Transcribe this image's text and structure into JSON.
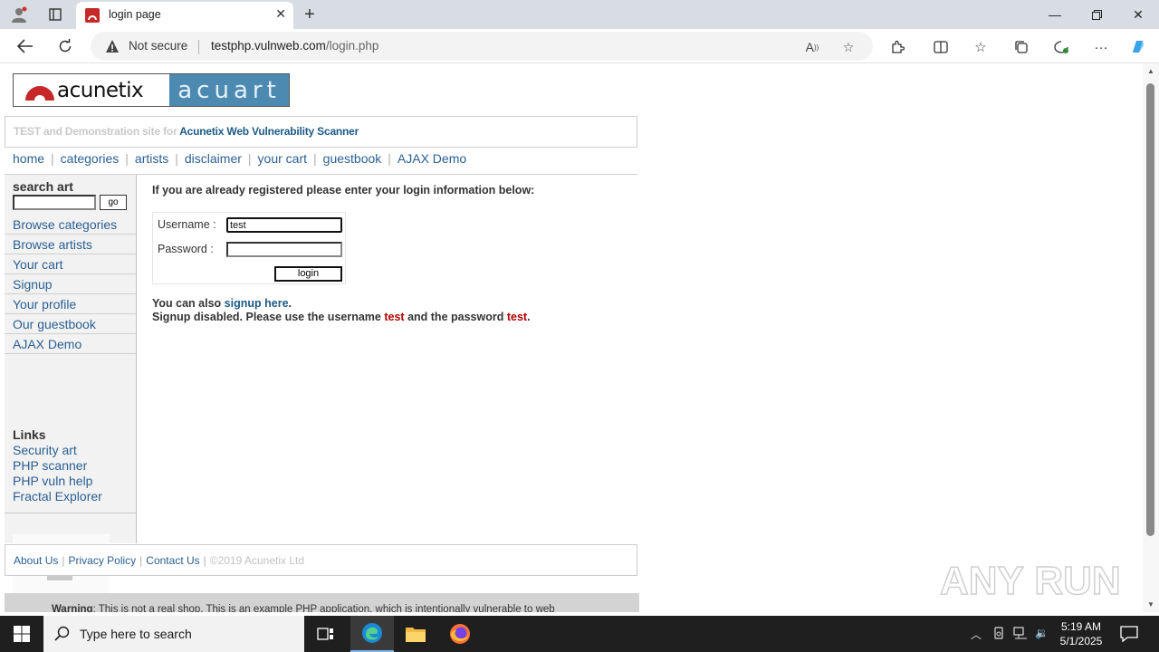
{
  "browser": {
    "tab_title": "login page",
    "security_label": "Not secure",
    "url_host": "testphp.vulnweb.com",
    "url_path": "/login.php"
  },
  "site": {
    "logo_left": "acunetix",
    "logo_right": "acuart",
    "tagline_prefix": "TEST and Demonstration site for",
    "tagline_strong": "Acunetix Web Vulnerability Scanner",
    "top_nav": [
      "home",
      "categories",
      "artists",
      "disclaimer",
      "your cart",
      "guestbook",
      "AJAX Demo"
    ],
    "search": {
      "title": "search art",
      "value": "",
      "button": "go"
    },
    "side_nav": [
      "Browse categories",
      "Browse artists",
      "Your cart",
      "Signup",
      "Your profile",
      "Our guestbook",
      "AJAX Demo"
    ],
    "links_title": "Links",
    "links": [
      "Security art",
      "PHP scanner",
      "PHP vuln help",
      "Fractal Explorer"
    ]
  },
  "login": {
    "intro": "If you are already registered please enter your login information below:",
    "username_label": "Username :",
    "username_value": "test",
    "password_label": "Password :",
    "password_value": "",
    "button": "login",
    "also_prefix": "You can also",
    "signup_link": "signup here",
    "also_suffix": ".",
    "disabled_prefix": "Signup disabled. Please use the username",
    "disabled_user": "test",
    "disabled_mid": "and the password",
    "disabled_pass": "test",
    "disabled_suffix": "."
  },
  "footer": {
    "links": [
      "About Us",
      "Privacy Policy",
      "Contact Us"
    ],
    "copyright": "©2019 Acunetix Ltd",
    "warning_strong": "Warning",
    "warning_text": ": This is not a real shop. This is an example PHP application, which is intentionally vulnerable to web"
  },
  "watermark": "ANY RUN",
  "taskbar": {
    "search_placeholder": "Type here to search",
    "time": "5:19 AM",
    "date": "5/1/2025"
  },
  "colors": {
    "link": "#2a5f93",
    "accent_red": "#b30000",
    "logo_blue": "#4d8ab2"
  }
}
